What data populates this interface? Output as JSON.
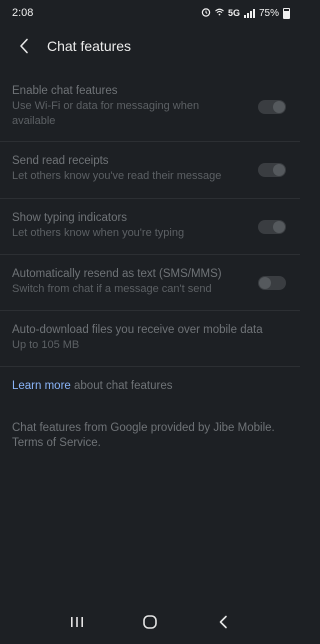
{
  "status_bar": {
    "time": "2:08",
    "network": "5G",
    "battery": "75%"
  },
  "header": {
    "title": "Chat features"
  },
  "settings": [
    {
      "title": "Enable chat features",
      "subtitle": "Use Wi-Fi or data for messaging when available",
      "toggle": "on"
    },
    {
      "title": "Send read receipts",
      "subtitle": "Let others know you've read their message",
      "toggle": "on"
    },
    {
      "title": "Show typing indicators",
      "subtitle": "Let others know when you're typing",
      "toggle": "on"
    },
    {
      "title": "Automatically resend as text (SMS/MMS)",
      "subtitle": "Switch from chat if a message can't send",
      "toggle": "off"
    },
    {
      "title": "Auto-download files you receive over mobile data",
      "subtitle": "Up to 105 MB"
    }
  ],
  "learn_more": {
    "link": "Learn more",
    "rest": " about chat features"
  },
  "footer": {
    "text": "Chat features from Google provided by Jibe Mobile. Terms of Service."
  },
  "colors": {
    "background": "#1d2024",
    "link": "#8ab4f8",
    "disabled_text": "#6f7377"
  }
}
